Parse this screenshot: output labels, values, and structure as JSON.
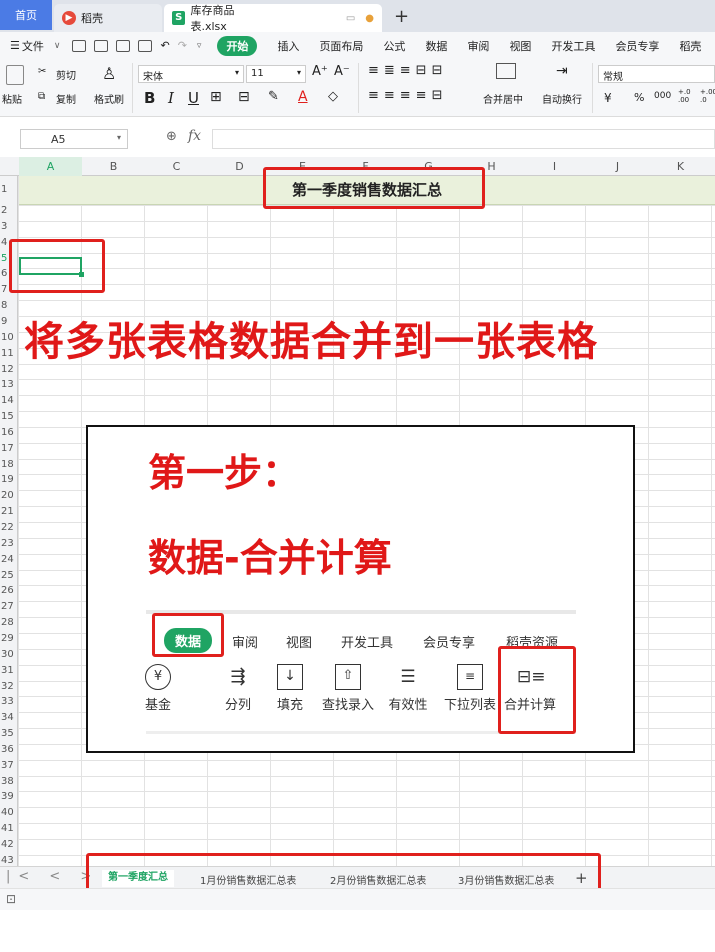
{
  "window_tabs": {
    "home": "首页",
    "daoke": "稻壳",
    "file": "库存商品表.xlsx",
    "file_icon": "S",
    "new_tab": "+"
  },
  "menu": {
    "items": [
      "文件",
      "开始",
      "插入",
      "页面布局",
      "公式",
      "数据",
      "审阅",
      "视图",
      "开发工具",
      "会员专享",
      "稻壳"
    ],
    "active": "开始"
  },
  "ribbon": {
    "paste": "粘贴",
    "cut": "剪切",
    "copy": "复制",
    "format_painter": "格式刷",
    "font_name": "宋体",
    "font_size": "11",
    "merge_center": "合并居中",
    "wrap": "自动换行",
    "number_format": "常规",
    "bold": "B",
    "italic": "I",
    "underline": "U",
    "currency": "¥",
    "percent": "%",
    "thousands": "000",
    "dec_inc": "+.0 .00",
    "dec_dec": "+.00 .0"
  },
  "formula_bar": {
    "cell_ref": "A5",
    "fx": "fx",
    "content": ""
  },
  "columns": [
    "A",
    "B",
    "C",
    "D",
    "E",
    "F",
    "G",
    "H",
    "I",
    "J",
    "K"
  ],
  "rows": [
    "1",
    "2",
    "3",
    "4",
    "5",
    "6",
    "7",
    "8",
    "9",
    "10",
    "11",
    "12",
    "13",
    "14",
    "15",
    "16",
    "17",
    "18",
    "19",
    "20",
    "21",
    "22",
    "23",
    "24",
    "25",
    "26",
    "27",
    "28",
    "29",
    "30",
    "31",
    "32",
    "33",
    "34",
    "35",
    "36",
    "37",
    "38",
    "39",
    "40",
    "41",
    "42",
    "43"
  ],
  "sheet": {
    "title": "第一季度销售数据汇总"
  },
  "annotation": {
    "headline": "将多张表格数据合并到一张表格",
    "step_title": "第一步：",
    "step_desc": "数据-合并计算"
  },
  "inset": {
    "tabs": [
      "数据",
      "审阅",
      "视图",
      "开发工具",
      "会员专享",
      "稻壳资源"
    ],
    "tools": [
      "基金",
      "分列",
      "填充",
      "查找录入",
      "有效性",
      "下拉列表",
      "合并计算"
    ]
  },
  "sheet_tabs": {
    "active": "第一季度汇总",
    "tabs": [
      "1月份销售数据汇总表",
      "2月份销售数据汇总表",
      "3月份销售数据汇总表"
    ],
    "add": "+",
    "nav": "|< < > >|"
  },
  "colors": {
    "accent_green": "#1fa463",
    "annotation_red": "#e01818",
    "title_fill": "#eaf1dc",
    "tab_home": "#4b7be5"
  }
}
